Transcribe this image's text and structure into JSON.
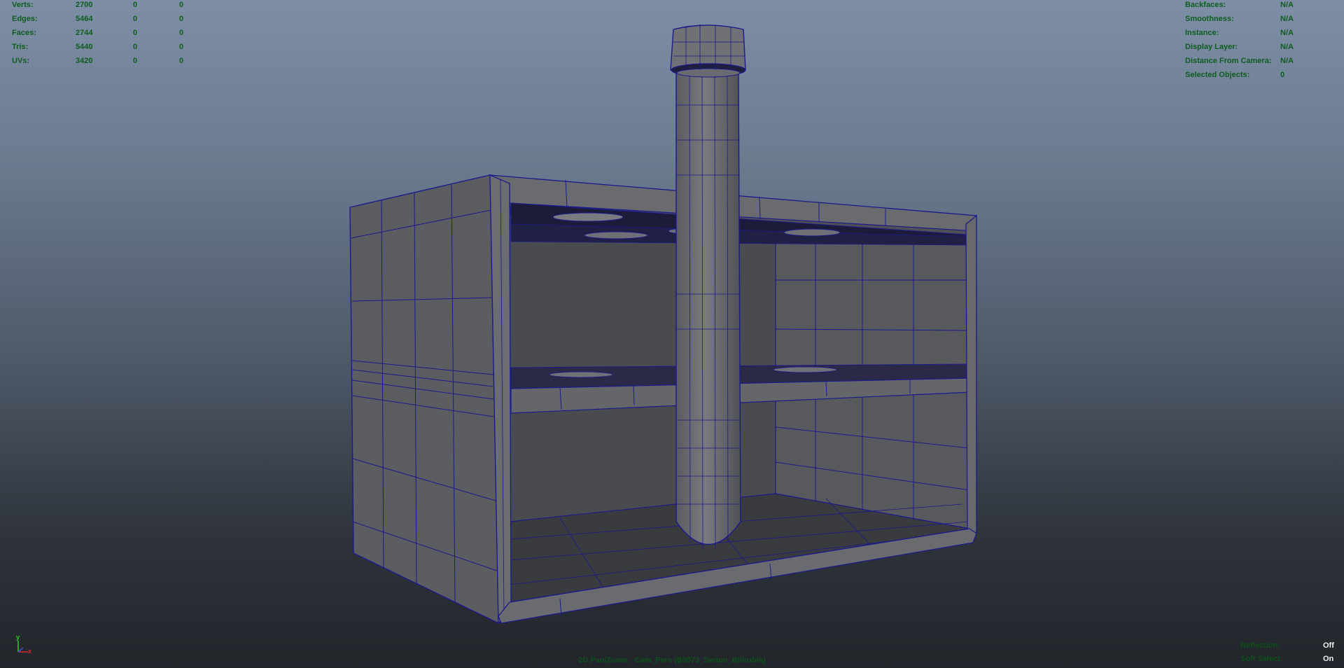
{
  "stats": [
    {
      "label": "Verts:",
      "v1": "2700",
      "v2": "0",
      "v3": "0"
    },
    {
      "label": "Edges:",
      "v1": "5464",
      "v2": "0",
      "v3": "0"
    },
    {
      "label": "Faces:",
      "v1": "2744",
      "v2": "0",
      "v3": "0"
    },
    {
      "label": "Tris:",
      "v1": "5440",
      "v2": "0",
      "v3": "0"
    },
    {
      "label": "UVs:",
      "v1": "3420",
      "v2": "0",
      "v3": "0"
    }
  ],
  "object_info": [
    {
      "label": "Backfaces:",
      "value": "N/A"
    },
    {
      "label": "Smoothness:",
      "value": "N/A"
    },
    {
      "label": "Instance:",
      "value": "N/A"
    },
    {
      "label": "Display Layer:",
      "value": "N/A"
    },
    {
      "label": "Distance From Camera:",
      "value": "N/A"
    },
    {
      "label": "Selected Objects:",
      "value": "0"
    }
  ],
  "status": {
    "camera_text": "2D Pan/Zoom : Cam_Pers (B0073_Serum_Bilirubin)",
    "reflection_label": "Reflection:",
    "reflection_value": "Off",
    "soft_select_label": "Soft Select:",
    "soft_select_value": "On"
  },
  "axis": {
    "y_label": "y",
    "x_label": "x"
  },
  "colors": {
    "hud_text": "#0f5c1f",
    "wire": "#1a1a8c",
    "shaded": "#5a5a5c",
    "background_top": "#7d8ea6",
    "background_bottom": "#22262b"
  }
}
